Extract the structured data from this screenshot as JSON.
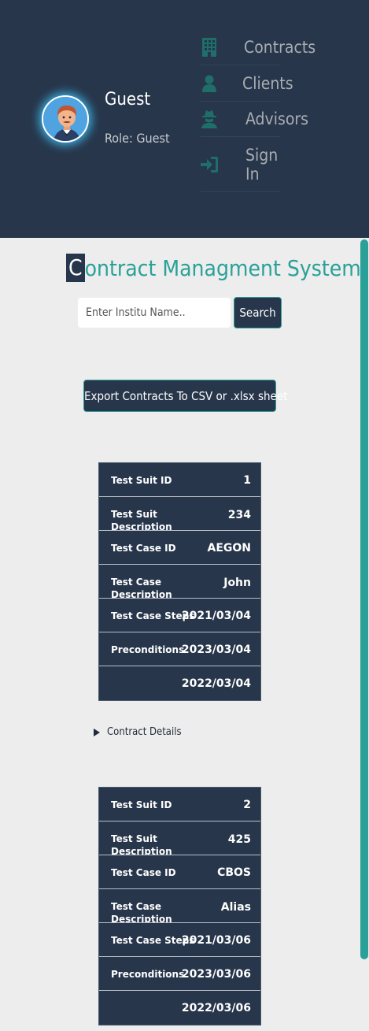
{
  "user": {
    "name": "Guest",
    "role": "Role: Guest"
  },
  "nav": {
    "items": [
      {
        "label": "Contracts",
        "icon": "building-icon"
      },
      {
        "label": "Clients",
        "icon": "user-icon"
      },
      {
        "label": "Advisors",
        "icon": "spy-icon"
      },
      {
        "label": "Sign In",
        "icon": "sign-in-icon"
      }
    ]
  },
  "main": {
    "title_first": "C",
    "title_rest": "ontract Managment System",
    "search": {
      "placeholder": "Enter Institu Name..",
      "button": "Search"
    },
    "export_label": "Export Contracts To CSV or .xlsx sheet",
    "details_label": "Contract Details"
  },
  "cards": [
    {
      "rows": [
        {
          "key": "Test Suit ID",
          "value": "1"
        },
        {
          "key": "Test Suit Description",
          "value": "234"
        },
        {
          "key": "Test Case ID",
          "value": "AEGON"
        },
        {
          "key": "Test Case Description",
          "value": "John"
        },
        {
          "key": "Test Case Steps",
          "value": "2021/03/04"
        },
        {
          "key": "Preconditions",
          "value": "2023/03/04"
        },
        {
          "key": "",
          "value": "2022/03/04"
        }
      ]
    },
    {
      "rows": [
        {
          "key": "Test Suit ID",
          "value": "2"
        },
        {
          "key": "Test Suit Description",
          "value": "425"
        },
        {
          "key": "Test Case ID",
          "value": "CBOS"
        },
        {
          "key": "Test Case Description",
          "value": "Alias"
        },
        {
          "key": "Test Case Steps",
          "value": "2021/03/06"
        },
        {
          "key": "Preconditions",
          "value": "2023/03/06"
        },
        {
          "key": "",
          "value": "2022/03/06"
        }
      ]
    }
  ],
  "colors": {
    "navy": "#27364b",
    "teal": "#2aa198",
    "background": "#ededed"
  }
}
